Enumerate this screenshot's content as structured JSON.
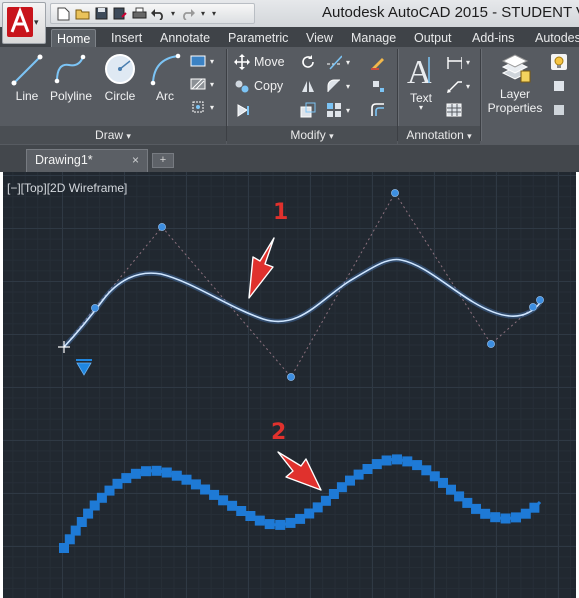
{
  "app": {
    "title": "Autodesk AutoCAD 2015 - STUDENT V",
    "logo_letter": "A"
  },
  "quick_access": {
    "icons": [
      "new-icon",
      "open-icon",
      "save-icon",
      "save-as-icon",
      "print-icon",
      "undo-icon",
      "redo-icon"
    ]
  },
  "tabs": [
    "Home",
    "Insert",
    "Annotate",
    "Parametric",
    "View",
    "Manage",
    "Output",
    "Add-ins",
    "Autodes"
  ],
  "active_tab": "Home",
  "ribbon": {
    "draw": {
      "title": "Draw",
      "buttons": [
        "Line",
        "Polyline",
        "Circle",
        "Arc"
      ]
    },
    "modify": {
      "title": "Modify",
      "move": "Move",
      "copy": "Copy"
    },
    "annotation": {
      "title": "Annotation",
      "text": "Text"
    },
    "layers": {
      "properties_line1": "Layer",
      "properties_line2": "Properties"
    }
  },
  "document": {
    "tab_name": "Drawing1*",
    "close_glyph": "×",
    "new_tab_glyph": "+"
  },
  "viewport": {
    "label": "[−][Top][2D Wireframe]",
    "marker_1": "1",
    "marker_2": "2"
  },
  "colors": {
    "spline": "#cfe6ff",
    "control_point": "#3d8ee0",
    "blocks": "#1e7ad6",
    "marker": "#e0312d",
    "canvas": "#212830"
  }
}
